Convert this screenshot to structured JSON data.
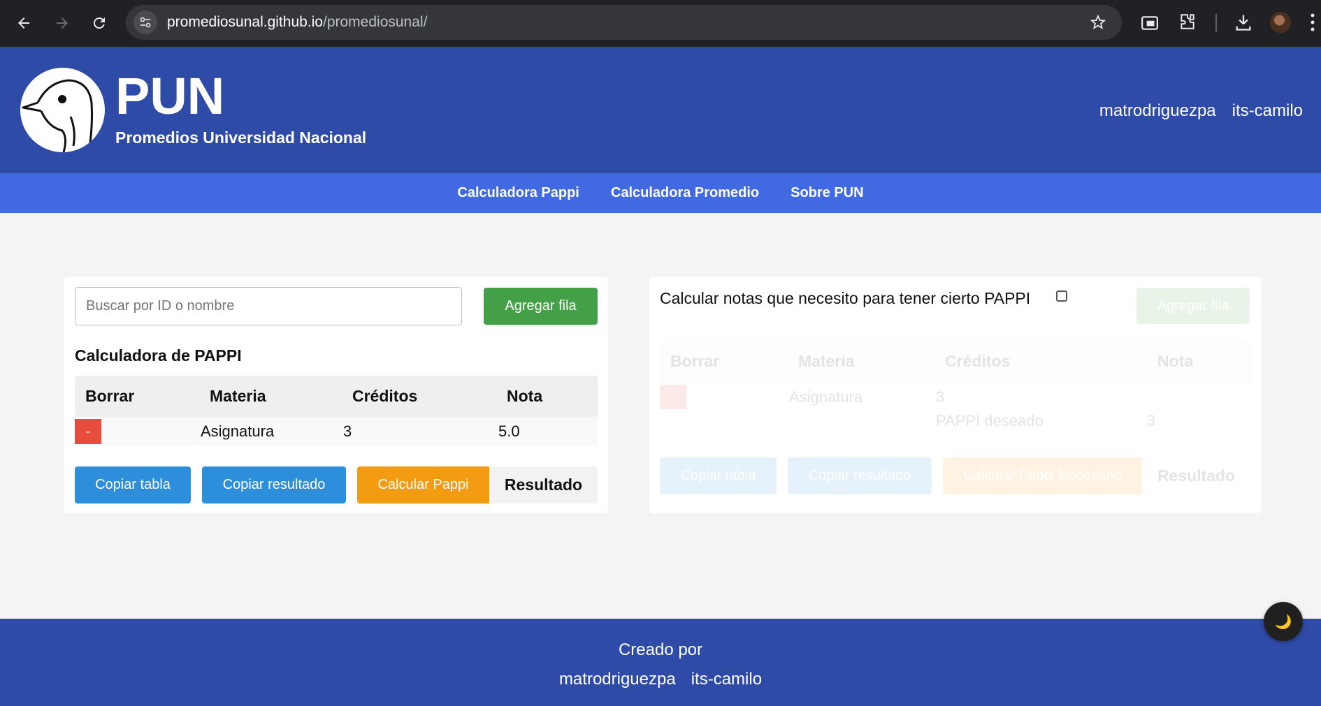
{
  "browser": {
    "url_host": "promediosunal.github.io",
    "url_path": "/promediosunal/"
  },
  "header": {
    "title": "PUN",
    "subtitle": "Promedios Universidad Nacional",
    "links": [
      "matrodriguezpa",
      "its-camilo"
    ]
  },
  "nav": {
    "items": [
      "Calculadora Pappi",
      "Calculadora Promedio",
      "Sobre PUN"
    ]
  },
  "left_card": {
    "search_placeholder": "Buscar por ID o nombre",
    "add_row_label": "Agregar fila",
    "section_title": "Calculadora de PAPPI",
    "columns": [
      "Borrar",
      "Materia",
      "Créditos",
      "Nota"
    ],
    "rows": [
      {
        "delete": "-",
        "materia": "Asignatura",
        "creditos": "3",
        "nota": "5.0"
      }
    ],
    "copy_table_label": "Copiar tabla",
    "copy_result_label": "Copiar resultado",
    "calc_label": "Calcular Pappi",
    "result_label": "Resultado"
  },
  "right_card": {
    "toggle_label": "Calcular notas que necesito para tener cierto PAPPI",
    "toggle_checked": false,
    "add_row_label": "Agregar fila",
    "columns": [
      "Borrar",
      "Materia",
      "Créditos",
      "Nota"
    ],
    "rows": [
      {
        "delete": "-",
        "materia": "Asignatura",
        "creditos": "3"
      }
    ],
    "desired_label": "PAPPI deseado",
    "desired_value": "3",
    "copy_table_label": "Copiar tabla",
    "copy_result_label": "Copiar resultado",
    "calc_label": "Calcular Pappi Necesario",
    "result_label": "Resultado"
  },
  "footer": {
    "created_by": "Creado por",
    "links": [
      "matrodriguezpa",
      "its-camilo"
    ]
  },
  "theme_toggle": {
    "icon": "moon-icon",
    "glyph": "🌙"
  },
  "colors": {
    "header": "#2f4ba8",
    "navbar": "#4169e1",
    "green": "#43a047",
    "blue": "#2d8fdc",
    "orange": "#f39c12",
    "red": "#e74c3c"
  }
}
